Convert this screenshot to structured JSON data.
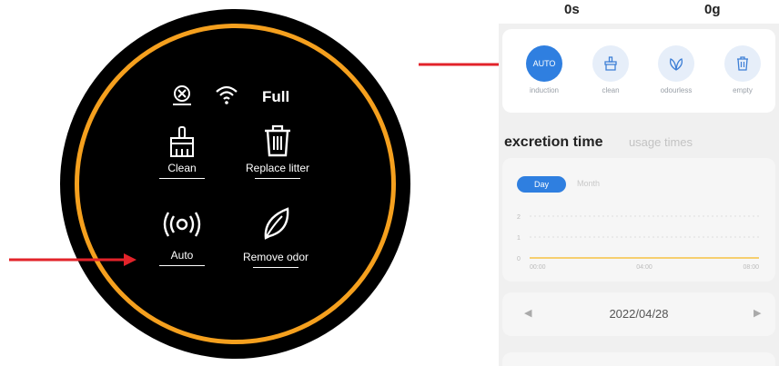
{
  "device": {
    "status_full": "Full",
    "controls": {
      "clean": "Clean",
      "replace": "Replace litter",
      "auto": "Auto",
      "odor": "Remove odor"
    },
    "ring_color": "#f5a01e"
  },
  "phone": {
    "stats": {
      "time": "0s",
      "weight": "0g"
    },
    "modes": [
      {
        "icon_text": "AUTO",
        "label": "induction",
        "active": true
      },
      {
        "icon": "brush-icon",
        "label": "clean"
      },
      {
        "icon": "leaf-icon",
        "label": "odourless"
      },
      {
        "icon": "trash-icon",
        "label": "empty"
      }
    ],
    "tabs": {
      "active": "excretion time",
      "inactive": "usage times"
    },
    "chart": {
      "pill_active": "Day",
      "pill_inactive": "Month"
    },
    "date": "2022/04/28"
  },
  "chart_data": {
    "type": "line",
    "x": [
      "00:00",
      "04:00",
      "08:00"
    ],
    "y_ticks": [
      "2",
      "1",
      "0"
    ],
    "series": [
      {
        "values": [
          0,
          0,
          0
        ]
      }
    ],
    "line_color": "#f5c242",
    "ylim": [
      0,
      2
    ]
  },
  "accent_color": "#2f7fe0",
  "arrow_color": "#e2232a"
}
